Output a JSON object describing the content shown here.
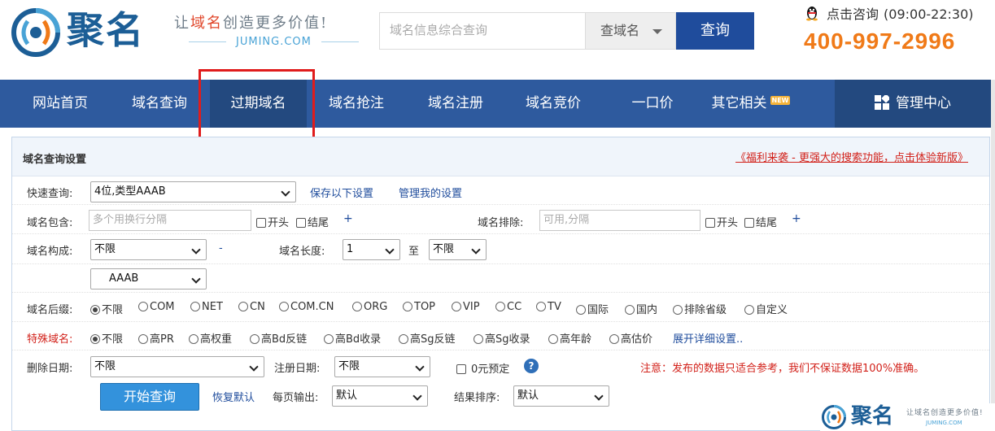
{
  "header": {
    "logo_name": "聚名",
    "slogan_prefix": "让",
    "slogan_highlight": "域名",
    "slogan_suffix": "创造更多价值!",
    "logo_domain": "JUMING.COM",
    "search_placeholder": "域名信息综合查询",
    "search_type": "查域名",
    "search_button": "查询",
    "qq_label": "点击咨询",
    "qq_hours": "(09:00-22:30)",
    "phone": "400-997-2996"
  },
  "nav": {
    "items": [
      "网站首页",
      "域名查询",
      "过期域名",
      "域名抢注",
      "域名注册",
      "域名竞价",
      "一口价",
      "其它相关"
    ],
    "new_badge": "NEW",
    "admin": "管理中心",
    "active_index": 2
  },
  "panel": {
    "title": "域名查询设置",
    "promo": "《福利来袭 - 更强大的搜索功能，点击体验新版》",
    "quick_label": "快速查询:",
    "quick_value": "4位,类型AAAB",
    "save_settings": "保存以下设置",
    "manage_settings": "管理我的设置",
    "contain_label": "域名包含:",
    "contain_placeholder": "多个用换行分隔",
    "start_label": "开头",
    "end_label": "结尾",
    "plus": "+",
    "exclude_label": "域名排除:",
    "exclude_placeholder": "可用,分隔",
    "compose_label": "域名构成:",
    "compose_value": "不限",
    "compose_dash": "-",
    "length_label": "域名长度:",
    "length_from": "1",
    "length_to_label": "至",
    "length_to": "不限",
    "pattern_value": "AAAB",
    "suffix_label": "域名后缀:",
    "suffixes": [
      "不限",
      "COM",
      "NET",
      "CN",
      "COM.CN",
      "ORG",
      "TOP",
      "VIP",
      "CC",
      "TV",
      "国际",
      "国内",
      "排除省级",
      "自定义"
    ],
    "special_label": "特殊域名:",
    "specials": [
      "不限",
      "高PR",
      "高权重",
      "高Bd反链",
      "高Bd收录",
      "高Sg反链",
      "高Sg收录",
      "高年龄",
      "高估价"
    ],
    "expand_link": "展开详细设置..",
    "delete_date_label": "删除日期:",
    "delete_date_value": "不限",
    "reg_date_label": "注册日期:",
    "reg_date_value": "不限",
    "zero_reserve": "0元预定",
    "help": "?",
    "notice": "注意：发布的数据只适合参考，我们不保证数据100%准确。",
    "start_button": "开始查询",
    "reset_link": "恢复默认",
    "per_page_label": "每页输出:",
    "per_page_value": "默认",
    "sort_label": "结果排序:",
    "sort_value": "默认"
  },
  "footer_logo": {
    "name": "聚名",
    "slogan": "让域名创造更多价值!",
    "domain": "JUMING.COM"
  },
  "colors": {
    "brand_blue": "#2e5a9e",
    "nav_active": "#23497f",
    "phone_orange": "#f07a18",
    "alert_red": "#d2211a",
    "link_blue": "#1f4c9c"
  }
}
